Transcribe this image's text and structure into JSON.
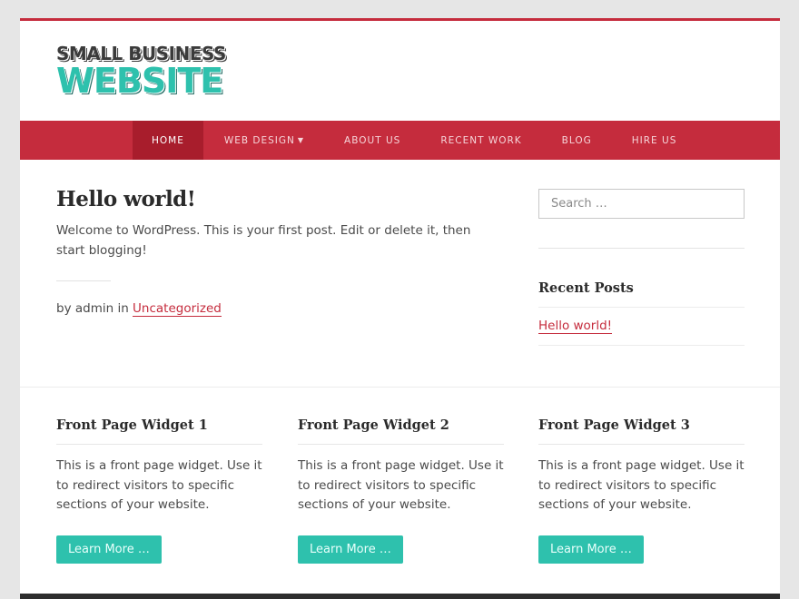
{
  "site": {
    "logo_line1": "SMALL BUSINESS",
    "logo_line2": "WEBSITE"
  },
  "nav": {
    "items": [
      {
        "label": "HOME",
        "active": true
      },
      {
        "label": "WEB DESIGN",
        "has_dropdown": true
      },
      {
        "label": "ABOUT US"
      },
      {
        "label": "RECENT WORK"
      },
      {
        "label": "BLOG"
      },
      {
        "label": "HIRE US"
      }
    ],
    "dropdown_icon": "caret-down-icon"
  },
  "post": {
    "title": "Hello world!",
    "body": "Welcome to WordPress. This is your first post. Edit or delete it, then start blogging!",
    "meta_prefix": "by admin in ",
    "category": "Uncategorized"
  },
  "sidebar": {
    "search_placeholder": "Search …",
    "recent_posts_title": "Recent Posts",
    "recent_posts": [
      "Hello world!"
    ]
  },
  "front_widgets": [
    {
      "title": "Front Page Widget 1",
      "text": "This is a front page widget. Use it to redirect visitors to specific sections of your website.",
      "button": "Learn More …"
    },
    {
      "title": "Front Page Widget 2",
      "text": "This is a front page widget. Use it to redirect visitors to specific sections of your website.",
      "button": "Learn More …"
    },
    {
      "title": "Front Page Widget 3",
      "text": "This is a front page widget. Use it to redirect visitors to specific sections of your website.",
      "button": "Learn More …"
    }
  ],
  "colors": {
    "accent": "#c52c3d",
    "accent_dark": "#a81d2c",
    "teal": "#2ec1ad",
    "background": "#e6e6e6",
    "footer": "#2d2d2d"
  }
}
